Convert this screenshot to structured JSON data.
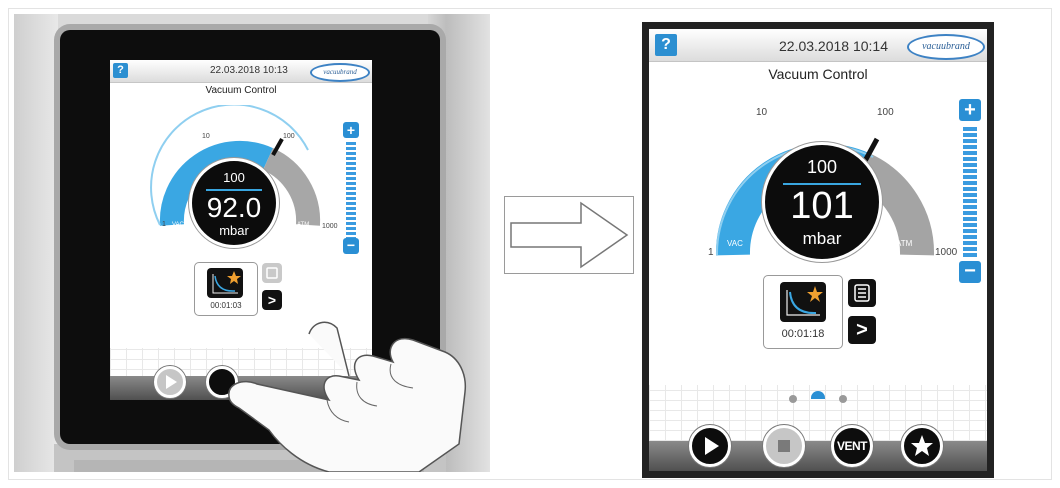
{
  "header": {
    "help_label": "?",
    "small_datetime": "22.03.2018   10:13",
    "large_datetime": "22.03.2018   10:14",
    "logo_text": "vacuubrand"
  },
  "title": "Vacuum Control",
  "gauge_small": {
    "setpoint": "100",
    "value": "92.0",
    "unit": "mbar",
    "tick_1": "1",
    "tick_10": "10",
    "tick_100": "100",
    "tick_1000": "1000",
    "vac": "VAC",
    "atm": "ATM"
  },
  "gauge_large": {
    "setpoint": "100",
    "value": "101",
    "unit": "mbar",
    "tick_1": "1",
    "tick_10": "10",
    "tick_100": "100",
    "tick_1000": "1000",
    "vac": "VAC",
    "atm": "ATM"
  },
  "slider": {
    "plus": "+",
    "minus": "−"
  },
  "program_small": {
    "time": "00:01:03",
    "next": ">"
  },
  "program_large": {
    "time": "00:01:18",
    "next": ">"
  },
  "controls": {
    "vent": "VENT"
  },
  "colors": {
    "accent": "#2a8fd4",
    "gauge_blue": "#3aa7e3",
    "gauge_grey": "#a0a0a0"
  }
}
